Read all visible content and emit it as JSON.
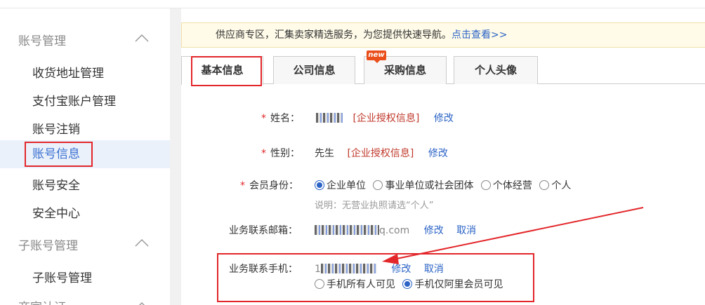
{
  "sidebar": {
    "groups": [
      {
        "title": "账号管理"
      },
      {
        "title": "子账号管理"
      },
      {
        "title": "商家认证"
      }
    ],
    "items": [
      {
        "label": "收货地址管理"
      },
      {
        "label": "支付宝账户管理"
      },
      {
        "label": "账号注销"
      },
      {
        "label": "账号信息"
      },
      {
        "label": "账号安全"
      },
      {
        "label": "安全中心"
      },
      {
        "label": "子账号管理"
      }
    ]
  },
  "notice": {
    "text": "供应商专区，汇集卖家精选服务，为您提供快速导航。",
    "link": "点击查看>>"
  },
  "tabs": [
    {
      "label": "基本信息"
    },
    {
      "label": "公司信息"
    },
    {
      "label": "采购信息"
    },
    {
      "label": "个人头像"
    }
  ],
  "new_badge": "new",
  "form": {
    "name": {
      "label": "姓名：",
      "value": "",
      "auth": "[企业授权信息]",
      "edit": "修改"
    },
    "gender": {
      "label": "性别：",
      "value": "先生",
      "auth": "[企业授权信息]",
      "edit": "修改"
    },
    "member_type": {
      "label": "会员身份：",
      "options": [
        "企业单位",
        "事业单位或社会团体",
        "个体经营",
        "个人"
      ],
      "selected": "企业单位",
      "hint": "说明：无营业执照请选“个人”"
    },
    "email": {
      "label": "业务联系邮箱：",
      "value_suffix": "q.com",
      "edit": "修改",
      "cancel": "取消"
    },
    "phone": {
      "label": "业务联系手机：",
      "value_prefix": "1",
      "edit": "修改",
      "cancel": "取消",
      "visibility_options": [
        "手机所有人可见",
        "手机仅阿里会员可见"
      ],
      "visibility_selected": "手机仅阿里会员可见"
    }
  },
  "colors": {
    "accent": "#2b63c6",
    "highlight": "#e3262a",
    "required": "#e3262a"
  }
}
